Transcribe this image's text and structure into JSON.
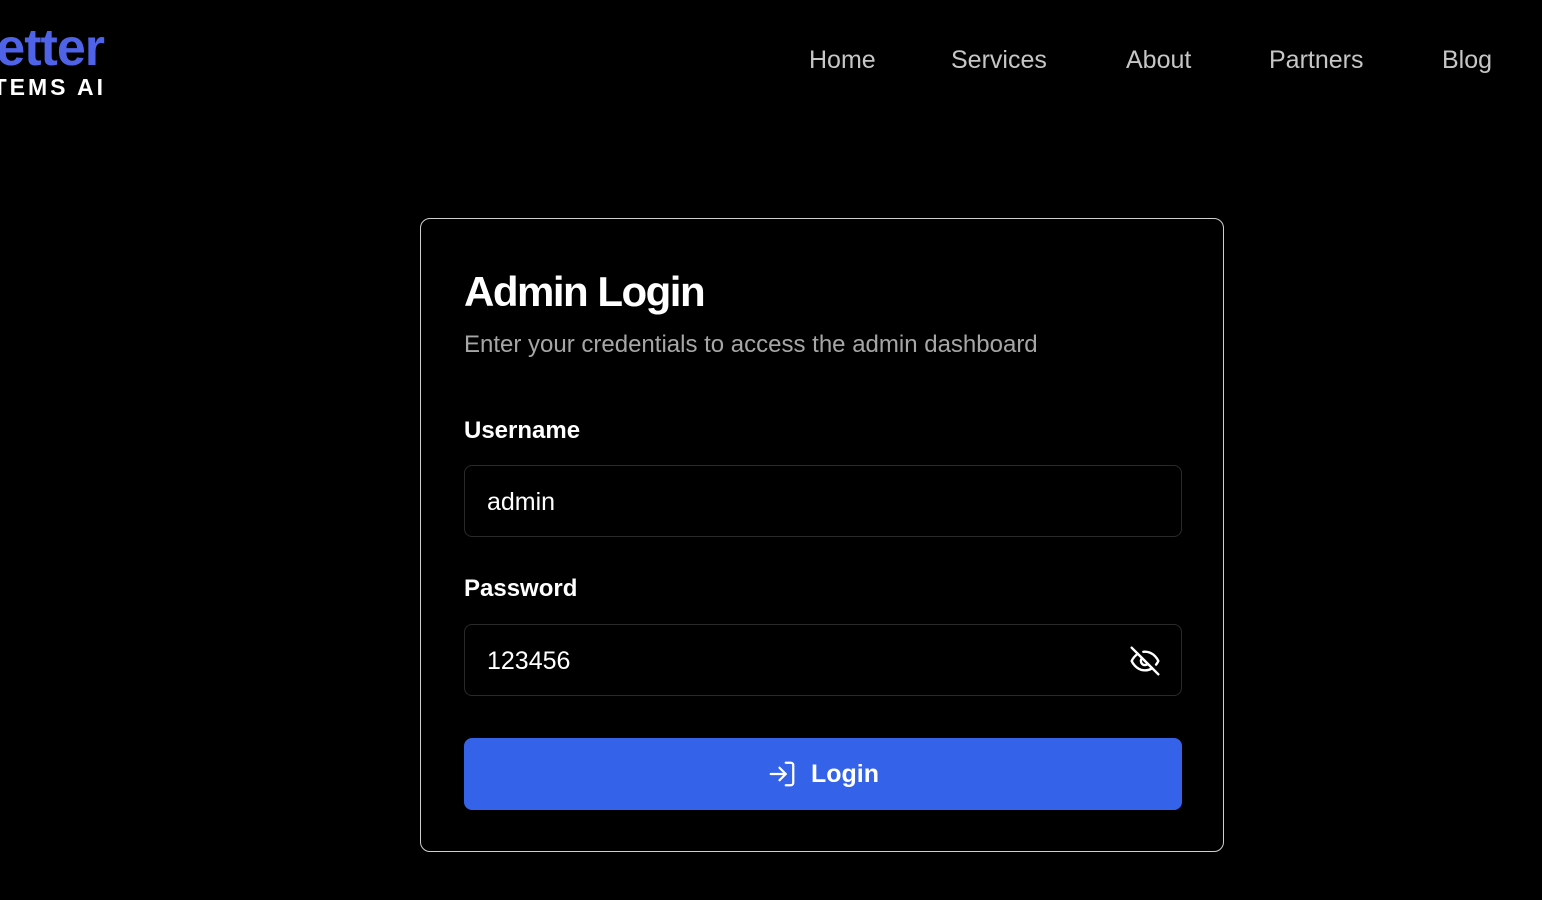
{
  "brand": {
    "logo_top": "etter",
    "logo_bottom": "TEMS AI",
    "accent_color": "#4f63e8"
  },
  "nav": {
    "items": [
      {
        "label": "Home"
      },
      {
        "label": "Services"
      },
      {
        "label": "About"
      },
      {
        "label": "Partners"
      },
      {
        "label": "Blog"
      }
    ]
  },
  "login": {
    "title": "Admin Login",
    "subtitle": "Enter your credentials to access the admin dashboard",
    "username": {
      "label": "Username",
      "value": "admin"
    },
    "password": {
      "label": "Password",
      "value": "123456",
      "toggle_icon": "eye-off-icon"
    },
    "button": {
      "label": "Login",
      "icon": "log-in-icon",
      "color": "#3462e8"
    }
  }
}
